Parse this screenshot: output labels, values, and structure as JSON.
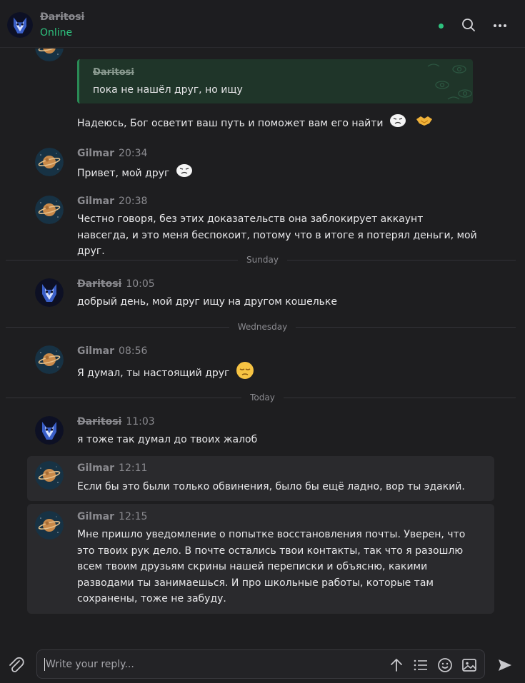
{
  "header": {
    "name": "Ðaritosi",
    "status": "Online"
  },
  "quote": {
    "author": "Ðaritosi",
    "text": "пока не нашёл друг, но ищу"
  },
  "first_text": "Надеюсь, Бог осветит ваш путь и поможет вам его найти",
  "messages": [
    {
      "author": "Gilmar",
      "time": "20:34",
      "text": "Привет, мой друг"
    },
    {
      "author": "Gilmar",
      "time": "20:38",
      "text": "Честно говоря, без этих доказательств она заблокирует аккаунт навсегда, и это меня беспокоит, потому что в итоге я потерял деньги, мой друг."
    },
    {
      "author": "Ðaritosi",
      "time": "10:05",
      "text": "добрый день, мой друг ищу на другом кошельке"
    },
    {
      "author": "Gilmar",
      "time": "08:56",
      "text": "Я думал, ты настоящий друг"
    },
    {
      "author": "Ðaritosi",
      "time": "11:03",
      "text": "я тоже так думал до твоих жалоб"
    },
    {
      "author": "Gilmar",
      "time": "12:11",
      "text": "Если бы это были только обвинения, было бы ещё ладно, вор ты эдакий."
    },
    {
      "author": "Gilmar",
      "time": "12:15",
      "text": "Мне пришло уведомление о попытке восстановления почты. Уверен, что это твоих рук дело. В почте остались твои контакты, так что я разошлю всем твоим друзьям скрины нашей переписки и объясню, какими разводами ты занимаешься. И про школьные работы, которые там сохранены, тоже не забуду."
    }
  ],
  "dividers": [
    "Sunday",
    "Wednesday",
    "Today"
  ],
  "composer": {
    "placeholder": "Write your reply..."
  },
  "colors": {
    "accent": "#2ec27e",
    "background": "#1e1e20",
    "quote_bg": "#1f3529"
  },
  "icons": [
    "search-icon",
    "more-icon",
    "attach-icon",
    "upload-icon",
    "list-icon",
    "emoji-icon",
    "image-icon",
    "send-icon"
  ]
}
